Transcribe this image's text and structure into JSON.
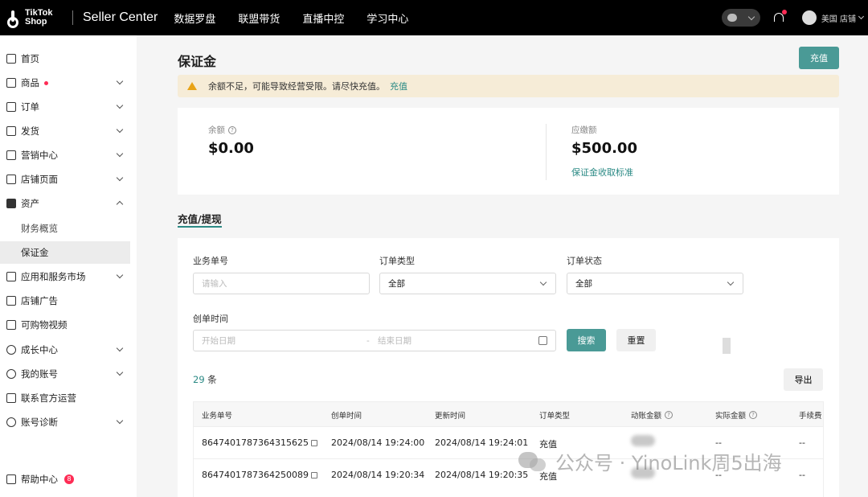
{
  "topbar": {
    "logo_line1": "TikTok",
    "logo_line2": "Shop",
    "brand": "Seller Center",
    "nav": [
      "数据罗盘",
      "联盟带货",
      "直播中控",
      "学习中心"
    ],
    "store_name": "美国 店铺"
  },
  "sidebar": {
    "items": [
      {
        "label": "首页"
      },
      {
        "label": "商品"
      },
      {
        "label": "订单"
      },
      {
        "label": "发货"
      },
      {
        "label": "营销中心"
      },
      {
        "label": "店铺页面"
      },
      {
        "label": "资产"
      },
      {
        "label": "应用和服务市场"
      },
      {
        "label": "店铺广告"
      },
      {
        "label": "可购物视频"
      },
      {
        "label": "成长中心"
      },
      {
        "label": "我的账号"
      },
      {
        "label": "联系官方运营"
      },
      {
        "label": "账号诊断"
      }
    ],
    "sub_items": [
      "财务概览",
      "保证金"
    ],
    "help": "帮助中心",
    "help_badge": "8"
  },
  "page": {
    "title": "保证金",
    "recharge_button": "充值",
    "alert_text": "余额不足，可能导致经营受限。请尽快充值。",
    "alert_link": "充值"
  },
  "balance": {
    "balance_label": "余额",
    "balance_value": "$0.00",
    "due_label": "应缴额",
    "due_value": "$500.00",
    "standard_link": "保证金收取标准"
  },
  "tab": "充值/提现",
  "filters": {
    "business_no_label": "业务单号",
    "business_no_placeholder": "请输入",
    "order_type_label": "订单类型",
    "order_type_value": "全部",
    "order_status_label": "订单状态",
    "order_status_value": "全部",
    "created_time_label": "创单时间",
    "start_placeholder": "开始日期",
    "date_separator": "-",
    "end_placeholder": "结束日期",
    "search_button": "搜索",
    "reset_button": "重置"
  },
  "results": {
    "count": "29",
    "count_unit": "条",
    "export_button": "导出"
  },
  "table": {
    "columns": [
      "业务单号",
      "创单时间",
      "更新时间",
      "订单类型",
      "动账金额",
      "实际金额",
      "手续费"
    ],
    "rows": [
      {
        "id": "8647401787364315625",
        "created": "2024/08/14 19:24:00",
        "updated": "2024/08/14 19:24:01",
        "type": "充值",
        "actual": "--",
        "fee": "--"
      },
      {
        "id": "8647401787364250089",
        "created": "2024/08/14 19:20:34",
        "updated": "2024/08/14 19:20:35",
        "type": "充值",
        "actual": "--",
        "fee": "--"
      }
    ]
  },
  "watermark": "公众号 · YinoLink周5出海"
}
